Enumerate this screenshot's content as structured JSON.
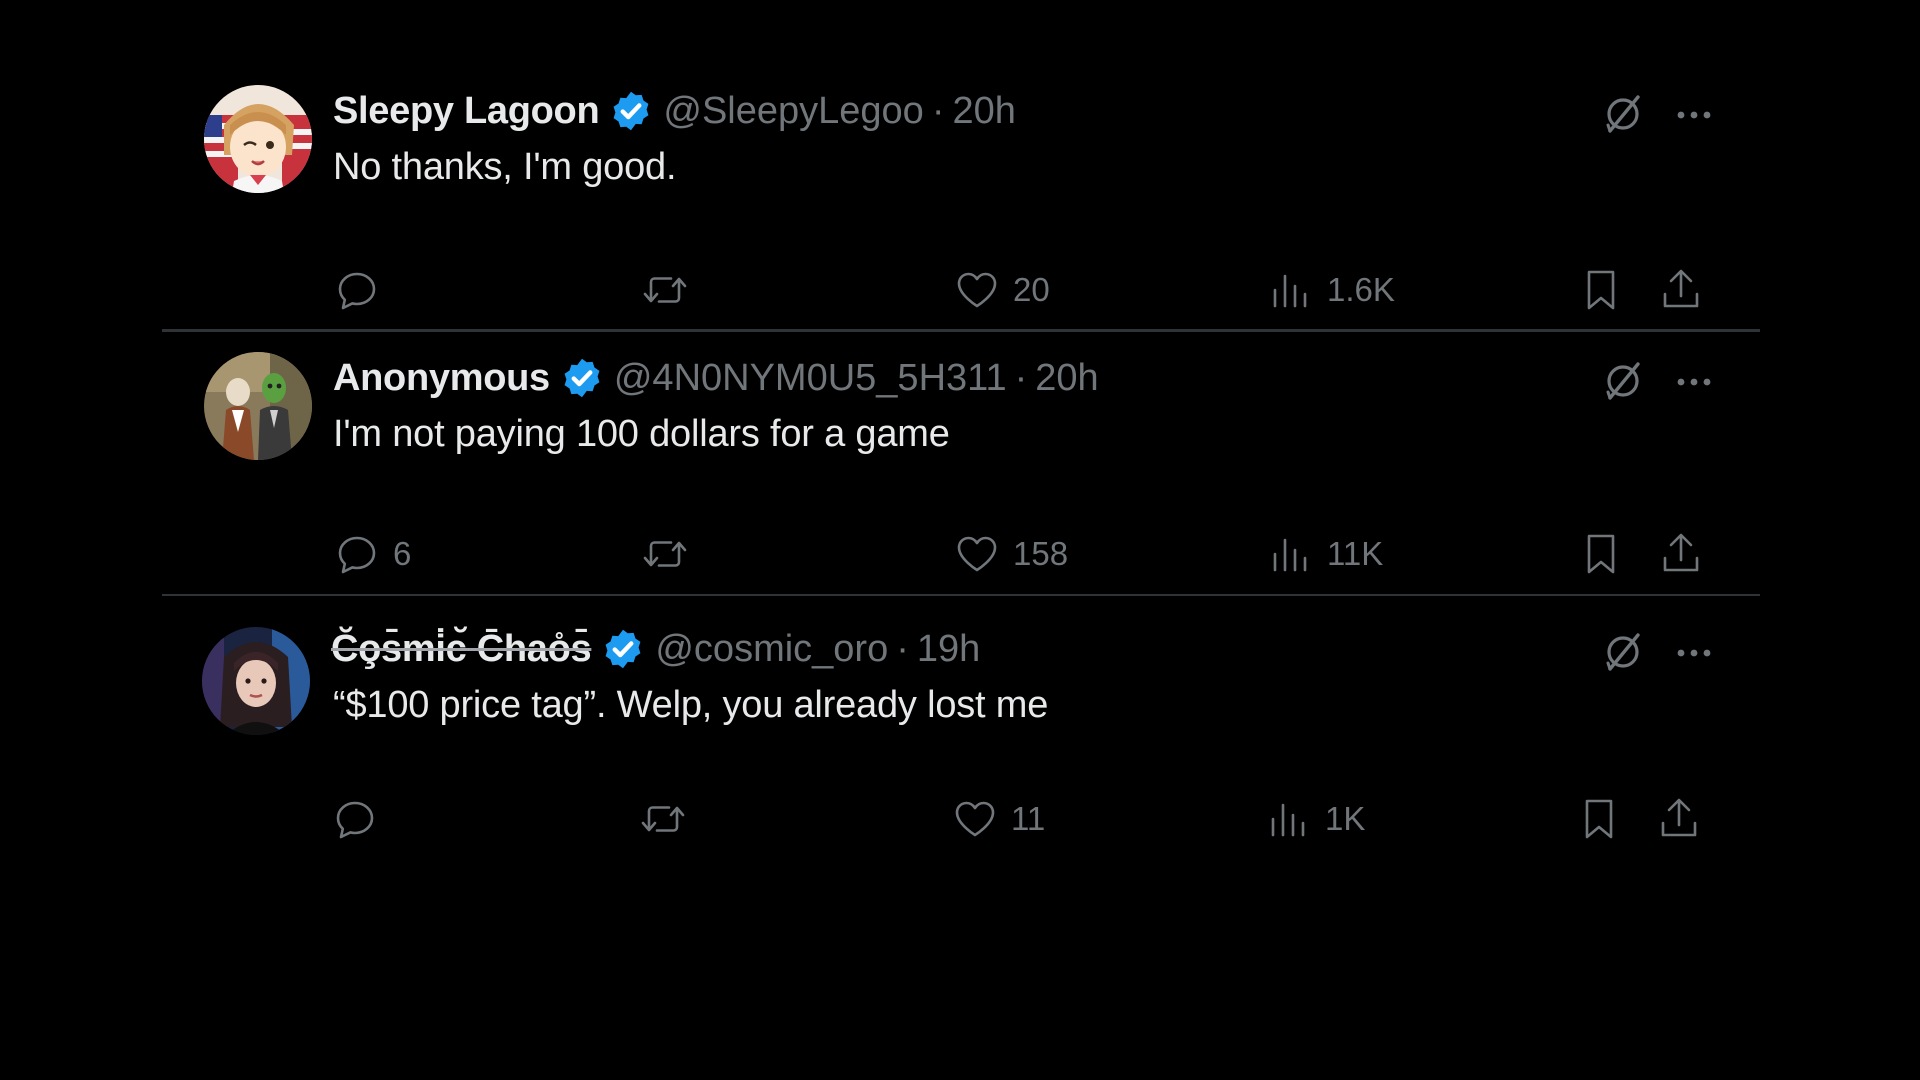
{
  "colors": {
    "background": "#000000",
    "primary_text": "#e7e9ea",
    "secondary_text": "#71767b",
    "verified_badge": "#1d9bf0",
    "divider": "#2f3336"
  },
  "tweets": [
    {
      "display_name": "Sleepy Lagoon",
      "verified": true,
      "handle": "@SleepyLegoo",
      "separator": "·",
      "time": "20h",
      "text": "No thanks, I'm good.",
      "avatar_icon": "anime-girl-avatar",
      "reply_count": "",
      "retweet_count": "",
      "like_count": "20",
      "view_count": "1.6K"
    },
    {
      "display_name": "Anonymous",
      "verified": true,
      "handle": "@4N0NYM0U5_5H311",
      "separator": "·",
      "time": "20h",
      "text": "I'm not paying 100 dollars for a game",
      "avatar_icon": "two-figures-avatar",
      "reply_count": "6",
      "retweet_count": "",
      "like_count": "158",
      "view_count": "11K"
    },
    {
      "display_name": "C̆o̧s̄mi̇c̆ C̄hao̊s̄",
      "verified": true,
      "handle": "@cosmic_oro",
      "separator": "·",
      "time": "19h",
      "text": "“$100 price tag”. Welp, you already lost me",
      "avatar_icon": "portrait-avatar",
      "reply_count": "",
      "retweet_count": "",
      "like_count": "11",
      "view_count": "1K"
    }
  ],
  "icons": {
    "verified": "verified-badge-icon",
    "grok": "grok-icon",
    "more": "more-options-icon",
    "reply": "reply-icon",
    "retweet": "retweet-icon",
    "like": "heart-icon",
    "views": "views-chart-icon",
    "bookmark": "bookmark-icon",
    "share": "share-icon"
  }
}
